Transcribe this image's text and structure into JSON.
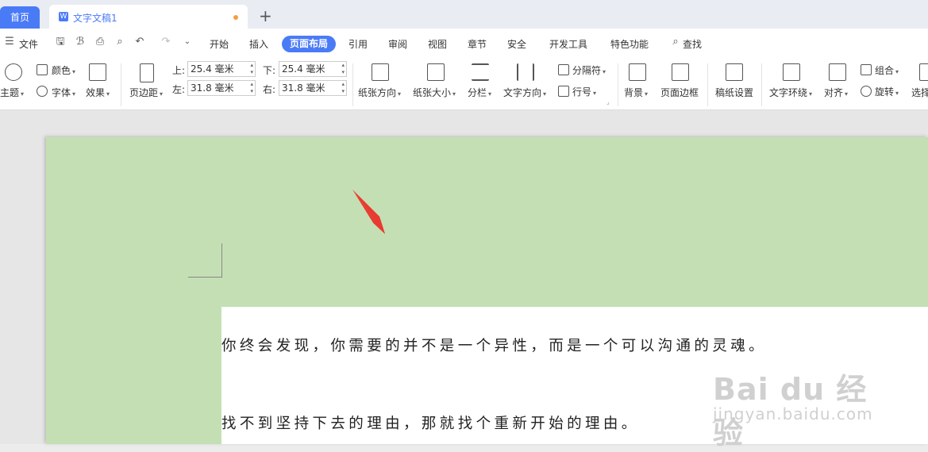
{
  "tabs": {
    "home": "首页",
    "document": "文字文稿1",
    "new_tab": "+"
  },
  "menu": {
    "file": "文件",
    "items": [
      "开始",
      "插入",
      "页面布局",
      "引用",
      "审阅",
      "视图",
      "章节",
      "安全",
      "开发工具",
      "特色功能"
    ],
    "active": "页面布局",
    "search": "查找"
  },
  "ribbon": {
    "theme": "主题",
    "color": "颜色",
    "font": "字体",
    "effect": "效果",
    "margins": "页边距",
    "margin_top_label": "上:",
    "margin_top": "25.4 毫米",
    "margin_bottom_label": "下:",
    "margin_bottom": "25.4 毫米",
    "margin_left_label": "左:",
    "margin_left": "31.8 毫米",
    "margin_right_label": "右:",
    "margin_right": "31.8 毫米",
    "orientation": "纸张方向",
    "size": "纸张大小",
    "columns": "分栏",
    "text_direction": "文字方向",
    "breaks": "分隔符",
    "line_numbers": "行号",
    "background": "背景",
    "page_border": "页面边框",
    "manuscript": "稿纸设置",
    "wrap": "文字环绕",
    "align": "对齐",
    "group": "组合",
    "rotate": "旋转",
    "select": "选择"
  },
  "document": {
    "paragraphs": [
      "你终会发现，你需要的并不是一个异性，而是一个可以沟通的灵魂。",
      "找不到坚持下去的理由，那就找个重新开始的理由。"
    ],
    "page_color": "#c5dfb4"
  },
  "watermark": {
    "brand": "Bai du 经验",
    "url": "jingyan.baidu.com"
  }
}
